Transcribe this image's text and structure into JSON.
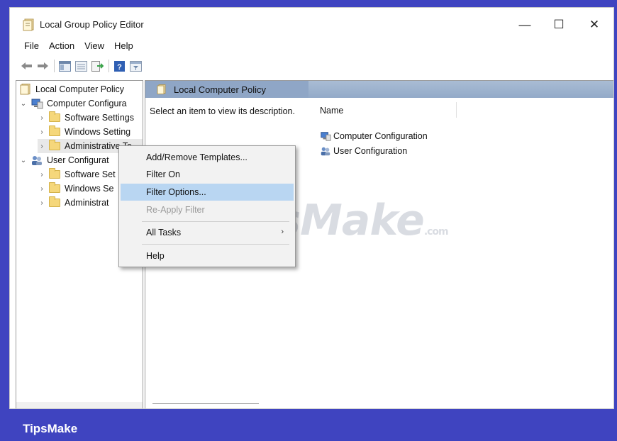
{
  "window": {
    "title": "Local Group Policy Editor",
    "controls": {
      "minimize": "—",
      "maximize": "☐",
      "close": "✕"
    }
  },
  "menu": [
    "File",
    "Action",
    "View",
    "Help"
  ],
  "toolbar_icons": [
    "back-arrow-icon",
    "forward-arrow-icon",
    "show-hide-tree-icon",
    "properties-icon",
    "export-list-icon",
    "help-icon",
    "filter-icon"
  ],
  "tree": {
    "root": "Local Computer Policy",
    "items": [
      {
        "label": "Computer Configura",
        "level": 1,
        "expanded": true
      },
      {
        "label": "Software Settings",
        "level": 2
      },
      {
        "label": "Windows Setting",
        "level": 2
      },
      {
        "label": "Administrative Te",
        "level": 2
      },
      {
        "label": "User Configurat",
        "level": 1,
        "expanded": true
      },
      {
        "label": "Software Set",
        "level": 2
      },
      {
        "label": "Windows Se",
        "level": 2
      },
      {
        "label": "Administrat",
        "level": 2
      }
    ]
  },
  "right_pane": {
    "header": "Local Computer Policy",
    "description": "Select an item to view its description.",
    "column_name": "Name",
    "items": [
      "Computer Configuration",
      "User Configuration"
    ]
  },
  "context_menu": {
    "items": [
      {
        "label": "Add/Remove Templates...",
        "state": "normal"
      },
      {
        "label": "Filter On",
        "state": "normal"
      },
      {
        "label": "Filter Options...",
        "state": "highlighted"
      },
      {
        "label": "Re-Apply Filter",
        "state": "disabled"
      },
      {
        "label": "All Tasks",
        "state": "normal",
        "submenu": true
      },
      {
        "label": "Help",
        "state": "normal"
      }
    ]
  },
  "watermark": {
    "main": "TipsMake",
    "suffix": ".com"
  },
  "footer": {
    "label": "TipsMake"
  },
  "colors": {
    "frame": "#3f44c0",
    "highlight": "#b9d6f2",
    "header": "#93aac8"
  }
}
